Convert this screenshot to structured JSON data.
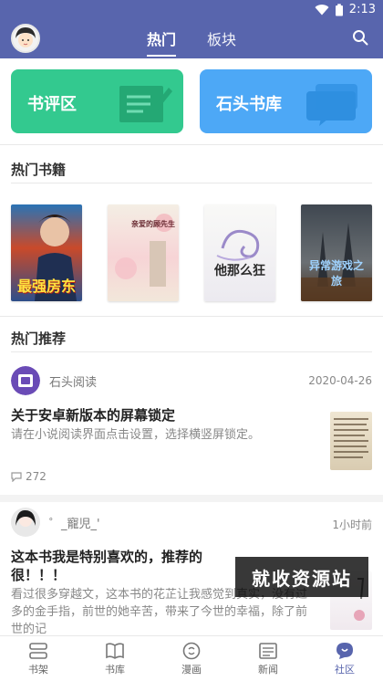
{
  "status_bar": {
    "time": "2:13"
  },
  "header": {
    "tabs": [
      {
        "label": "热门",
        "active": true
      },
      {
        "label": "板块",
        "active": false
      }
    ],
    "accent_color": "#5865ad"
  },
  "quick_cards": [
    {
      "label": "书评区",
      "color": "#33c98f"
    },
    {
      "label": "石头书库",
      "color": "#4da8f6"
    }
  ],
  "hot_books": {
    "title": "热门书籍",
    "books": [
      {
        "cover_text": "最强房东"
      },
      {
        "cover_text": "亲爱的顾先生"
      },
      {
        "cover_text": "他那么狂"
      },
      {
        "cover_text": "异常游戏之旅"
      }
    ]
  },
  "hot_recommend": {
    "title": "热门推荐",
    "posts": [
      {
        "author": "石头阅读",
        "date": "2020-04-26",
        "title": "关于安卓新版本的屏幕锁定",
        "body": "请在小说阅读界面点击设置，选择横竖屏锁定。",
        "comments": "272"
      },
      {
        "author": "゜_寵児_'",
        "date": "1小时前",
        "title": "这本书我是特别喜欢的，推荐的很！！！",
        "body": "看过很多穿越文，这本书的花芷让我感觉到真实，没有过多的金手指，前世的她辛苦，带来了今世的幸福，除了前世的记"
      }
    ]
  },
  "watermark": "就收资源站",
  "bottom_nav": [
    {
      "label": "书架",
      "icon": "bookshelf-icon",
      "active": false
    },
    {
      "label": "书库",
      "icon": "open-book-icon",
      "active": false
    },
    {
      "label": "漫画",
      "icon": "comic-icon",
      "active": false
    },
    {
      "label": "新闻",
      "icon": "news-icon",
      "active": false
    },
    {
      "label": "社区",
      "icon": "community-icon",
      "active": true
    }
  ]
}
